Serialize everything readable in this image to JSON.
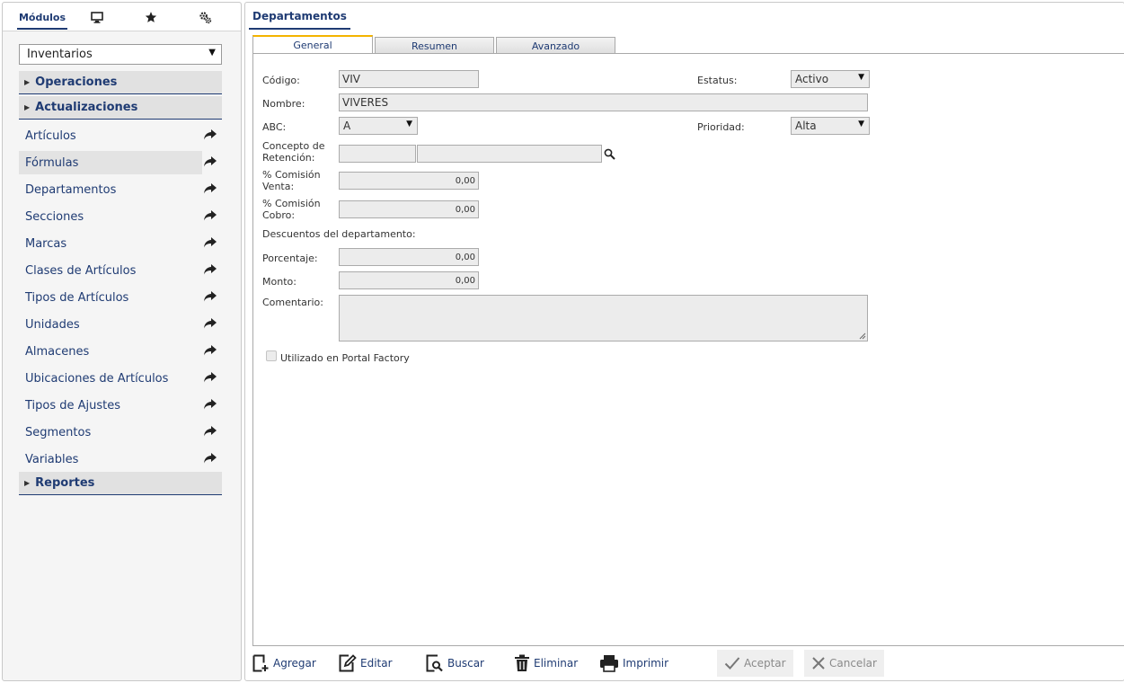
{
  "left": {
    "tabs": {
      "modulos": "Módulos"
    },
    "module_select": "Inventarios",
    "groups": {
      "operaciones": "Operaciones",
      "actualizaciones": "Actualizaciones",
      "reportes": "Reportes"
    },
    "items": [
      "Artículos",
      "Fórmulas",
      "Departamentos",
      "Secciones",
      "Marcas",
      "Clases de Artículos",
      "Tipos de Artículos",
      "Unidades",
      "Almacenes",
      "Ubicaciones de Artículos",
      "Tipos de Ajustes",
      "Segmentos",
      "Variables"
    ]
  },
  "right": {
    "title": "Departamentos",
    "tabs": {
      "general": "General",
      "resumen": "Resumen",
      "avanzado": "Avanzado"
    },
    "form": {
      "codigo_label": "Código:",
      "codigo_value": "VIV",
      "estatus_label": "Estatus:",
      "estatus_value": "Activo",
      "nombre_label": "Nombre:",
      "nombre_value": "VIVERES",
      "abc_label": "ABC:",
      "abc_value": "A",
      "prioridad_label": "Prioridad:",
      "prioridad_value": "Alta",
      "concepto_label_1": "Concepto de",
      "concepto_label_2": "Retención:",
      "comision_venta_label_1": "% Comisión",
      "comision_venta_label_2": "Venta:",
      "comision_venta_value": "0,00",
      "comision_cobro_label_1": "% Comisión",
      "comision_cobro_label_2": "Cobro:",
      "comision_cobro_value": "0,00",
      "descuentos_label": "Descuentos del departamento:",
      "porcentaje_label": "Porcentaje:",
      "porcentaje_value": "0,00",
      "monto_label": "Monto:",
      "monto_value": "0,00",
      "comentario_label": "Comentario:",
      "portal_label": "Utilizado en Portal Factory"
    },
    "toolbar": {
      "agregar": "Agregar",
      "editar": "Editar",
      "buscar": "Buscar",
      "eliminar": "Eliminar",
      "imprimir": "Imprimir",
      "aceptar": "Aceptar",
      "cancelar": "Cancelar"
    }
  },
  "colors": {
    "accent": "#1f3b73",
    "tab_highlight": "#f4b400"
  }
}
